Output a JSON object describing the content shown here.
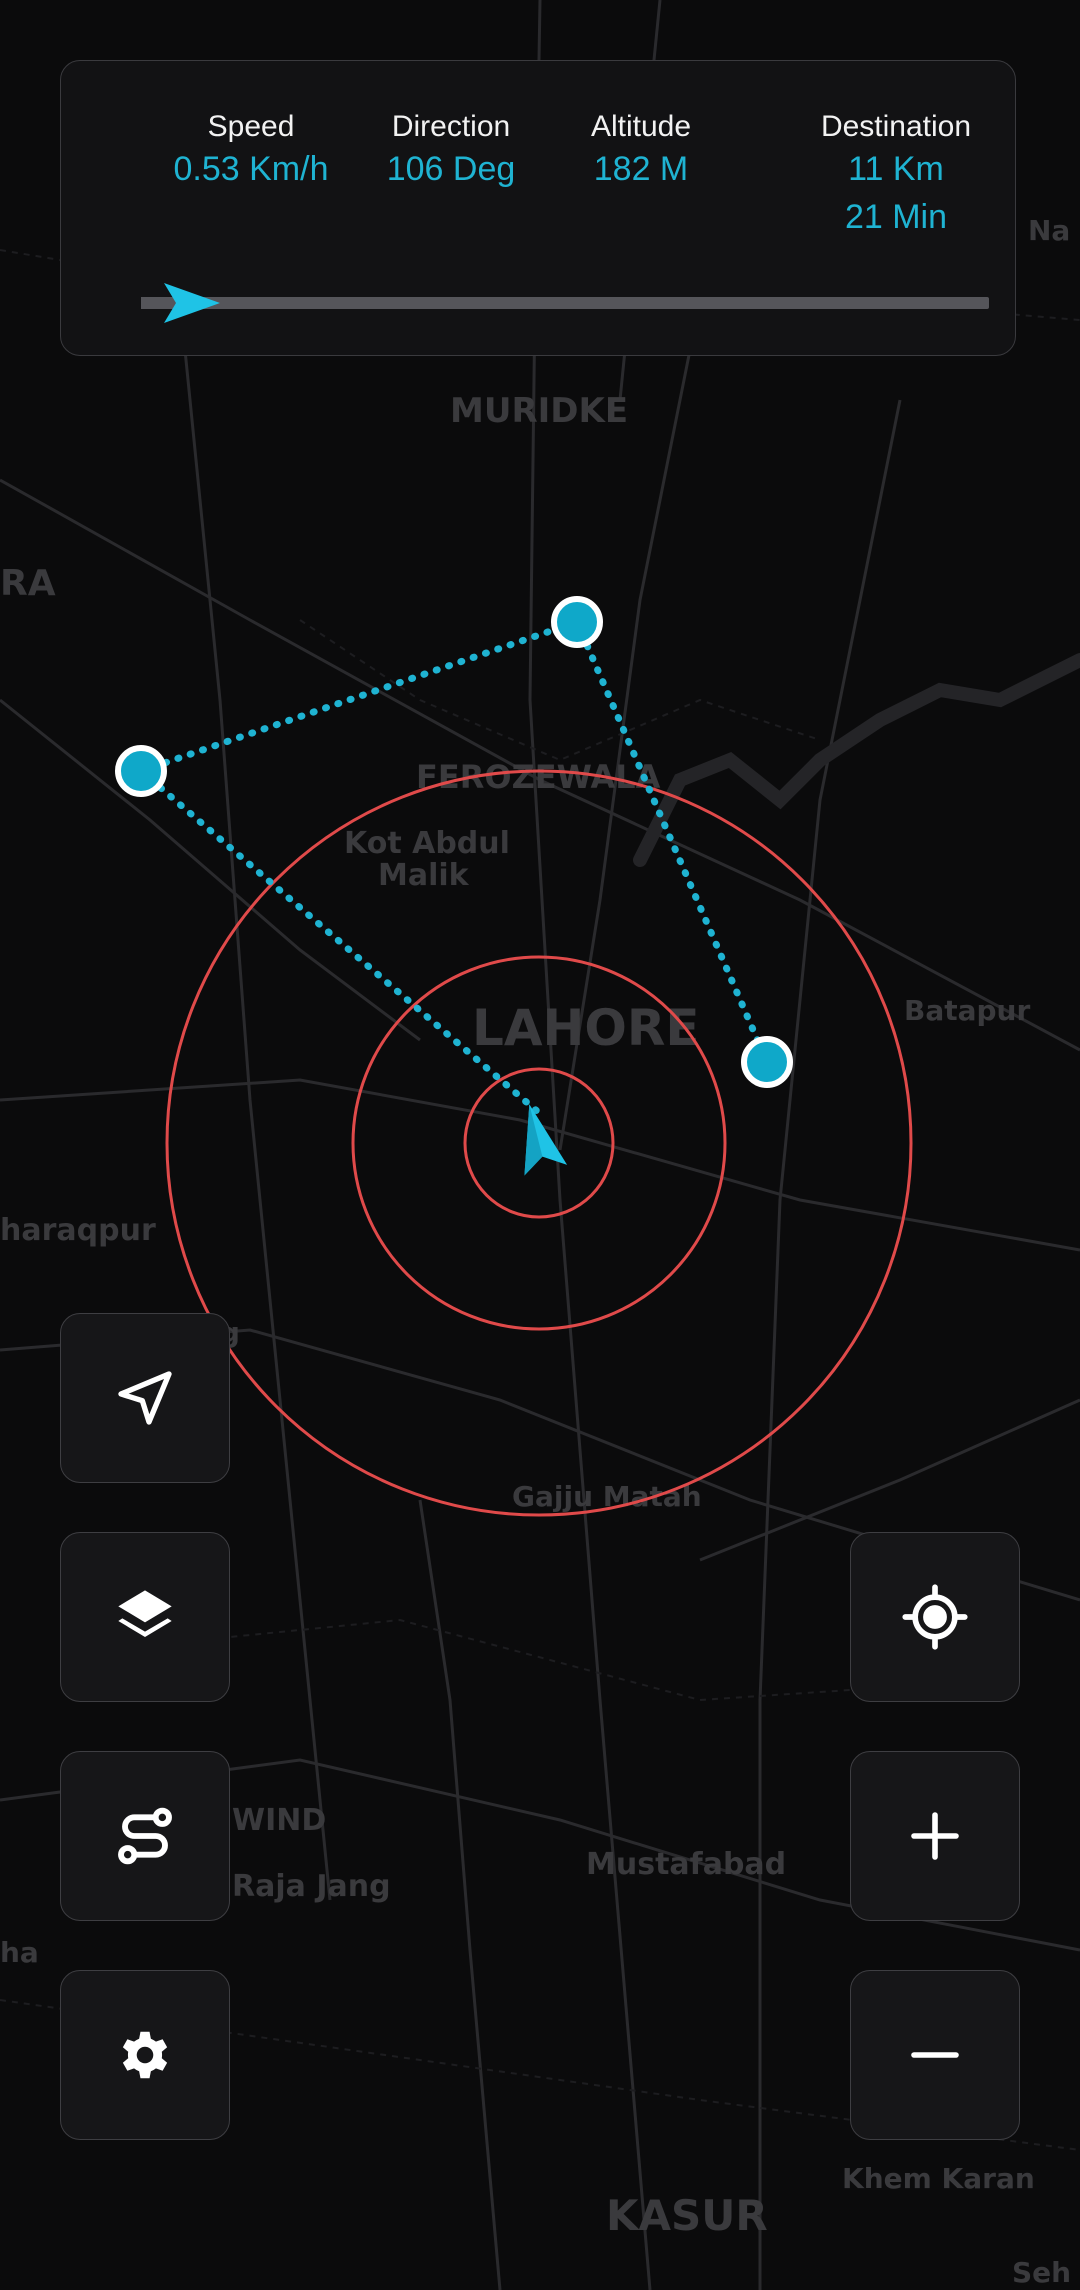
{
  "status_panel": {
    "speed": {
      "label": "Speed",
      "value": "0.53 Km/h"
    },
    "direction": {
      "label": "Direction",
      "value": "106 Deg"
    },
    "altitude": {
      "label": "Altitude",
      "value": "182 M"
    },
    "destination": {
      "label": "Destination",
      "distance": "11 Km",
      "time": "21 Min"
    },
    "progress_fraction": 0.06
  },
  "map": {
    "place_labels": [
      "MURIDKE",
      "RA",
      "FEROZEWALA",
      "Kot Abdul",
      "Malik",
      "LAHORE",
      "Batapur",
      "haraqpur",
      "ng",
      "Gajju Matah",
      "WIND",
      "Raja Jang",
      "Mustafabad",
      "ha",
      "Khem Karan",
      "KASUR",
      "Na",
      "Seh"
    ],
    "route_color": "#1fb3d2",
    "range_ring_color": "#e04a4a",
    "waypoint_count": 3
  },
  "controls": {
    "left": [
      {
        "name": "navigate-button",
        "icon": "navigation-arrow-icon"
      },
      {
        "name": "layers-button",
        "icon": "layers-icon"
      },
      {
        "name": "route-button",
        "icon": "route-icon"
      },
      {
        "name": "settings-button",
        "icon": "gear-icon"
      }
    ],
    "right": [
      {
        "name": "locate-button",
        "icon": "crosshair-icon"
      },
      {
        "name": "zoom-in-button",
        "icon": "plus-icon"
      },
      {
        "name": "zoom-out-button",
        "icon": "minus-icon"
      }
    ]
  }
}
